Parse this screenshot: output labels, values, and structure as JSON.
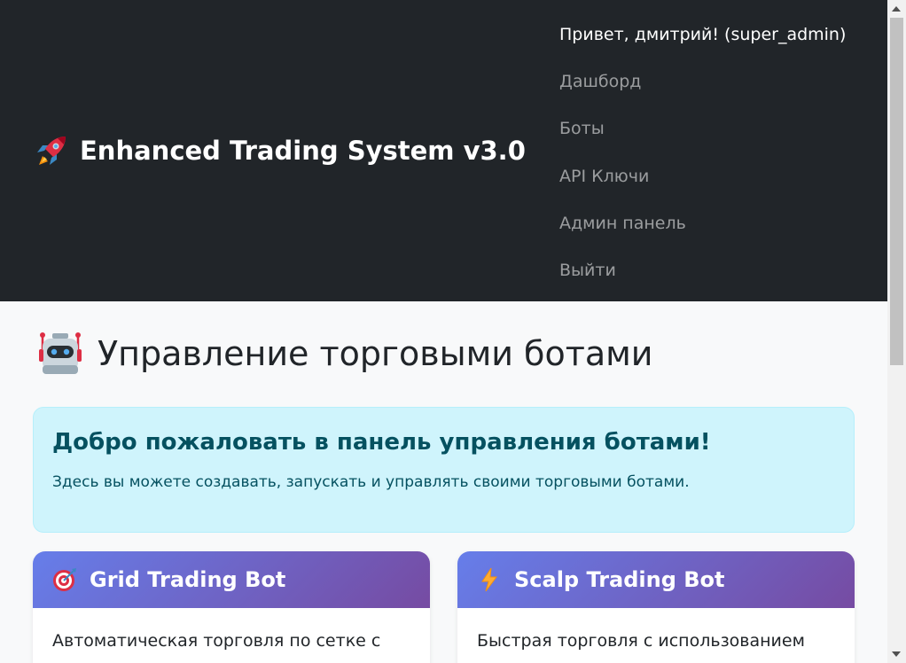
{
  "navbar": {
    "brand": "Enhanced Trading System v3.0",
    "brand_icon": "rocket-icon",
    "greeting": "Привет, дмитрий! (super_admin)",
    "items": [
      {
        "label": "Дашборд"
      },
      {
        "label": "Боты"
      },
      {
        "label": "API Ключи"
      },
      {
        "label": "Админ панель"
      },
      {
        "label": "Выйти"
      }
    ]
  },
  "main": {
    "title": "Управление торговыми ботами",
    "title_icon": "robot-icon",
    "alert": {
      "heading": "Добро пожаловать в панель управления ботами!",
      "text": "Здесь вы можете создавать, запускать и управлять своими торговыми ботами."
    },
    "cards": [
      {
        "title": "Grid Trading Bot",
        "icon": "target-icon",
        "description": "Автоматическая торговля по сетке с"
      },
      {
        "title": "Scalp Trading Bot",
        "icon": "lightning-icon",
        "description": "Быстрая торговля с использованием"
      }
    ]
  },
  "colors": {
    "navbar_bg": "#212529",
    "alert_bg": "#cff4fc",
    "alert_text": "#055160",
    "card_header_gradient_start": "#667eea",
    "card_header_gradient_end": "#764ba2"
  }
}
